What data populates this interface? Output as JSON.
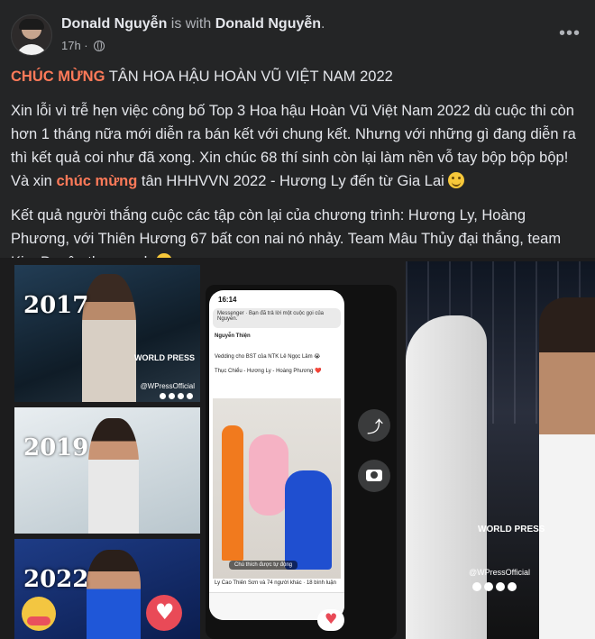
{
  "post": {
    "author": "Donald Nguyễn",
    "with_text": "is with",
    "tagged": "Donald Nguyễn",
    "period": ".",
    "time": "17h ·",
    "more_icon": "more-horizontal-icon",
    "privacy_icon": "globe-icon"
  },
  "body": {
    "headline_highlight": "CHÚC MỪNG",
    "headline_rest": " TÂN HOA HẬU HOÀN VŨ VIỆT NAM 2022",
    "p1_a": "Xin lỗi vì trễ hẹn việc công bố Top 3 Hoa hậu Hoàn Vũ Việt Nam 2022 dù cuộc thi còn hơn 1 tháng nữa mới diễn ra bán kết với chung kết. Nhưng với những gì đang diễn ra thì kết quả coi như đã xong. Xin chúc 68 thí sinh còn lại làm nền vỗ tay bộp bộp bộp! Và xin ",
    "p1_highlight": "chúc mừng",
    "p1_b": " tân HHHVVN 2022 - Hương Ly đến từ Gia Lai ",
    "p2": "Kết quả người thắng cuộc các tập còn lại của chương trình: Hương Ly, Hoàng Phương, với Thiên Hương 67 bất con nai nó nhảy. Team Mâu Thủy đại thắng, team Kim Duyên thua sạch "
  },
  "media": {
    "years": [
      "2017",
      "2019",
      "2022"
    ],
    "watermark_title": "WORLD PRESS",
    "watermark_handle": "@WPressOfficial",
    "phone": {
      "status_time": "16:14",
      "notification": "Messenger · Bạn đã trả lời một cuộc gọi của Nguyễn.",
      "author": "Nguyễn Thiện",
      "line1": "Vedding cho BST của NTK Lê Ngọc Lâm 😭",
      "line2": "Thục Chiểu - Hương Ly - Hoàng Phương ❤️",
      "caption": "Chú thích được tự động",
      "stats": "Ly Cao Thiên Sơn và 74 người khác · 18 bình luận"
    }
  }
}
